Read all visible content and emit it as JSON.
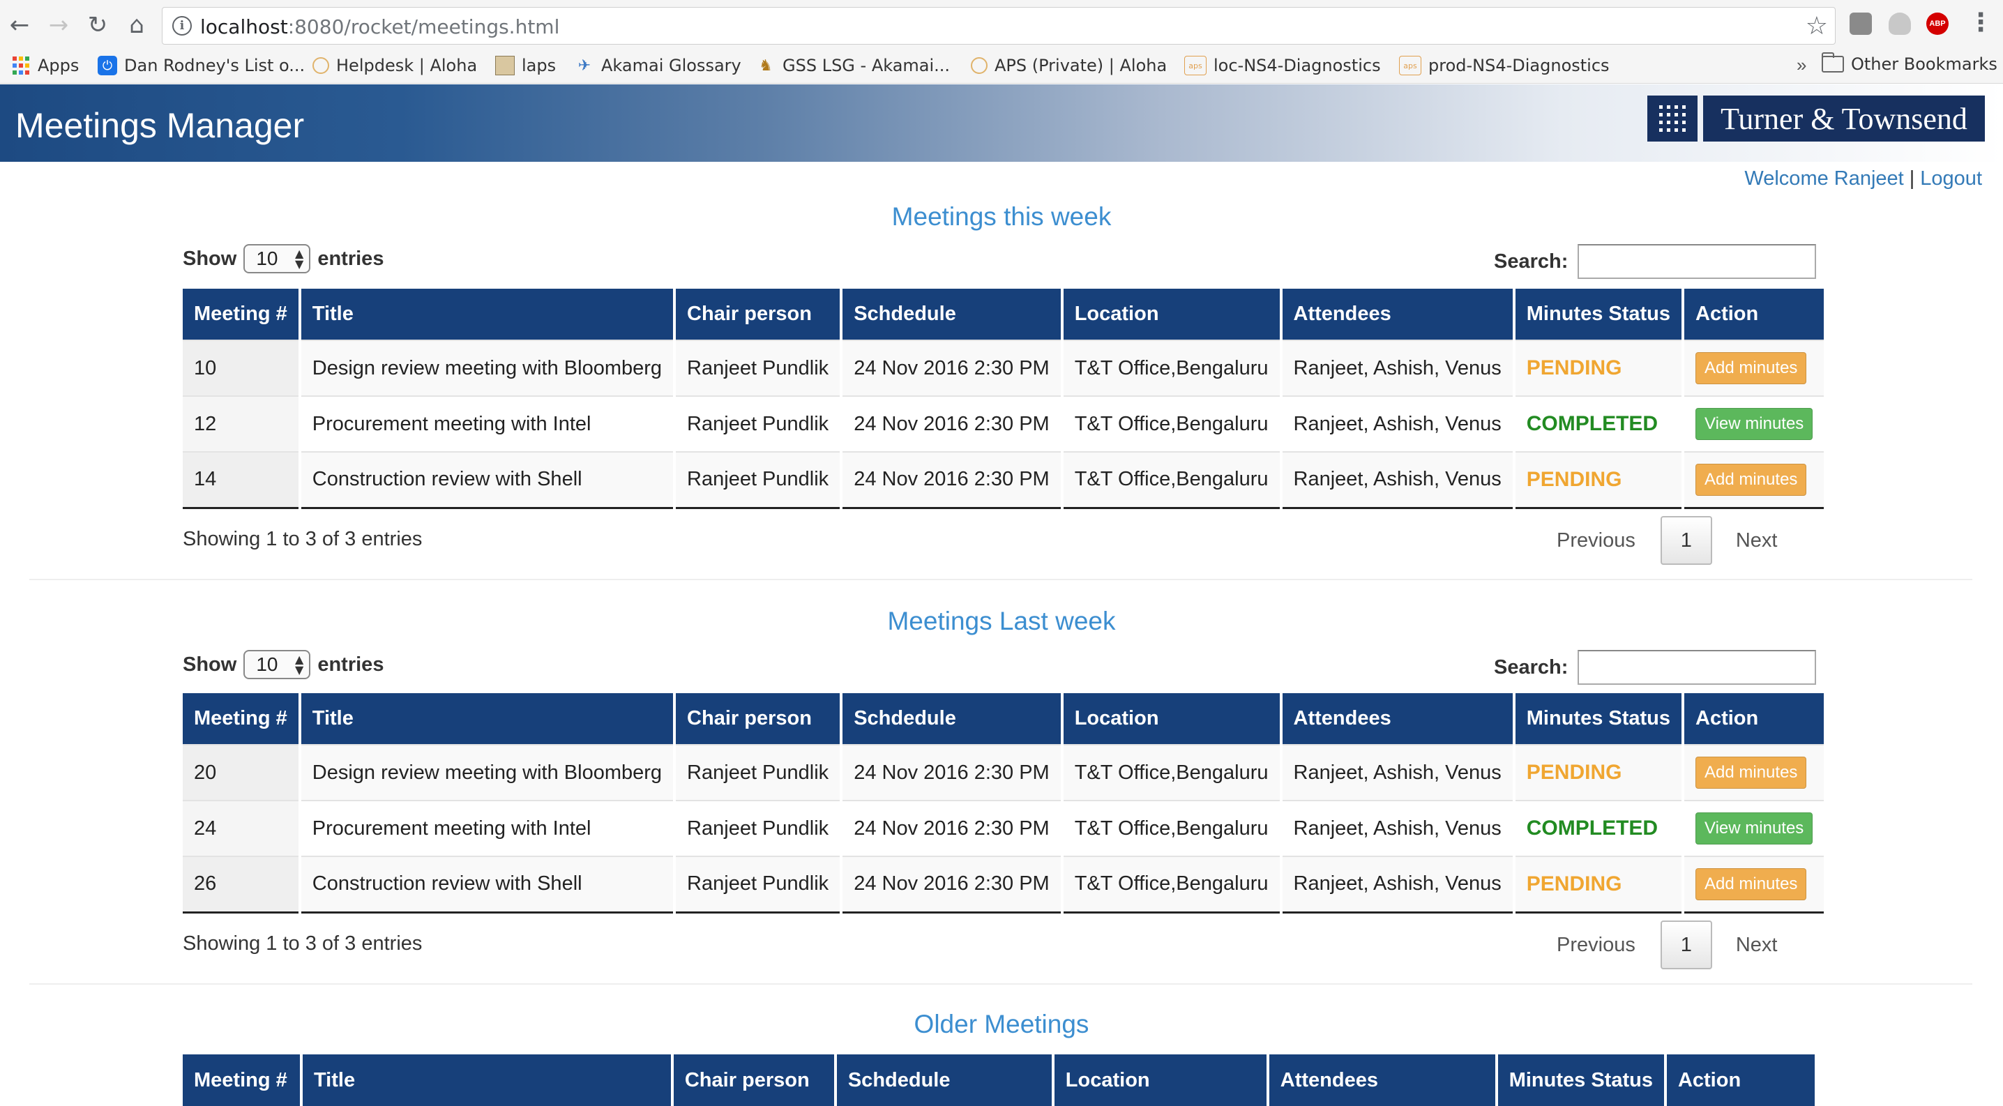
{
  "browser": {
    "url_host": "localhost",
    "url_rest": ":8080/rocket/meetings.html",
    "bookmarks": [
      {
        "label": "Apps",
        "icon": "apps-grid-icon"
      },
      {
        "label": "Dan Rodney's List o...",
        "icon": "power-icon"
      },
      {
        "label": "Helpdesk | Aloha",
        "icon": "ring-icon"
      },
      {
        "label": "laps",
        "icon": "image-icon"
      },
      {
        "label": "Akamai Glossary",
        "icon": "bird-icon"
      },
      {
        "label": "GSS LSG - Akamai...",
        "icon": "gss-icon"
      },
      {
        "label": "APS (Private) | Aloha",
        "icon": "ring-icon"
      },
      {
        "label": "loc-NS4-Diagnostics",
        "icon": "aps-icon"
      },
      {
        "label": "prod-NS4-Diagnostics",
        "icon": "aps-icon"
      }
    ],
    "more": "»",
    "other_bookmarks": "Other Bookmarks",
    "abp_label": "ABP"
  },
  "app": {
    "title": "Meetings Manager",
    "brand": "Turner & Townsend",
    "welcome": "Welcome Ranjeet",
    "separator": "|",
    "logout": "Logout"
  },
  "table_labels": {
    "show": "Show",
    "entries": "entries",
    "page_length": "10",
    "search": "Search:",
    "previous": "Previous",
    "next": "Next",
    "page": "1",
    "columns": [
      "Meeting #",
      "Title",
      "Chair person",
      "Schdedule",
      "Location",
      "Attendees",
      "Minutes Status",
      "Action"
    ]
  },
  "sections": [
    {
      "title": "Meetings this week",
      "info": "Showing 1 to 3 of 3 entries",
      "rows": [
        {
          "id": "10",
          "title": "Design review meeting with Bloomberg",
          "chair": "Ranjeet Pundlik",
          "schedule": "24 Nov 2016 2:30 PM",
          "location": "T&T Office,Bengaluru",
          "attendees": "Ranjeet, Ashish, Venus",
          "status": "PENDING",
          "action": "Add minutes"
        },
        {
          "id": "12",
          "title": "Procurement meeting with Intel",
          "chair": "Ranjeet Pundlik",
          "schedule": "24 Nov 2016 2:30 PM",
          "location": "T&T Office,Bengaluru",
          "attendees": "Ranjeet, Ashish, Venus",
          "status": "COMPLETED",
          "action": "View minutes"
        },
        {
          "id": "14",
          "title": "Construction review with Shell",
          "chair": "Ranjeet Pundlik",
          "schedule": "24 Nov 2016 2:30 PM",
          "location": "T&T Office,Bengaluru",
          "attendees": "Ranjeet, Ashish, Venus",
          "status": "PENDING",
          "action": "Add minutes"
        }
      ]
    },
    {
      "title": "Meetings Last week",
      "info": "Showing 1 to 3 of 3 entries",
      "rows": [
        {
          "id": "20",
          "title": "Design review meeting with Bloomberg",
          "chair": "Ranjeet Pundlik",
          "schedule": "24 Nov 2016 2:30 PM",
          "location": "T&T Office,Bengaluru",
          "attendees": "Ranjeet, Ashish, Venus",
          "status": "PENDING",
          "action": "Add minutes"
        },
        {
          "id": "24",
          "title": "Procurement meeting with Intel",
          "chair": "Ranjeet Pundlik",
          "schedule": "24 Nov 2016 2:30 PM",
          "location": "T&T Office,Bengaluru",
          "attendees": "Ranjeet, Ashish, Venus",
          "status": "COMPLETED",
          "action": "View minutes"
        },
        {
          "id": "26",
          "title": "Construction review with Shell",
          "chair": "Ranjeet Pundlik",
          "schedule": "24 Nov 2016 2:30 PM",
          "location": "T&T Office,Bengaluru",
          "attendees": "Ranjeet, Ashish, Venus",
          "status": "PENDING",
          "action": "Add minutes"
        }
      ]
    },
    {
      "title": "Older Meetings",
      "rows": []
    }
  ],
  "colors": {
    "header_blue": "#17407a",
    "link_blue": "#337ab7",
    "pending": "#f0a631",
    "completed": "#228b22",
    "add_button": "#f0ad4e",
    "view_button": "#5cb85c"
  }
}
